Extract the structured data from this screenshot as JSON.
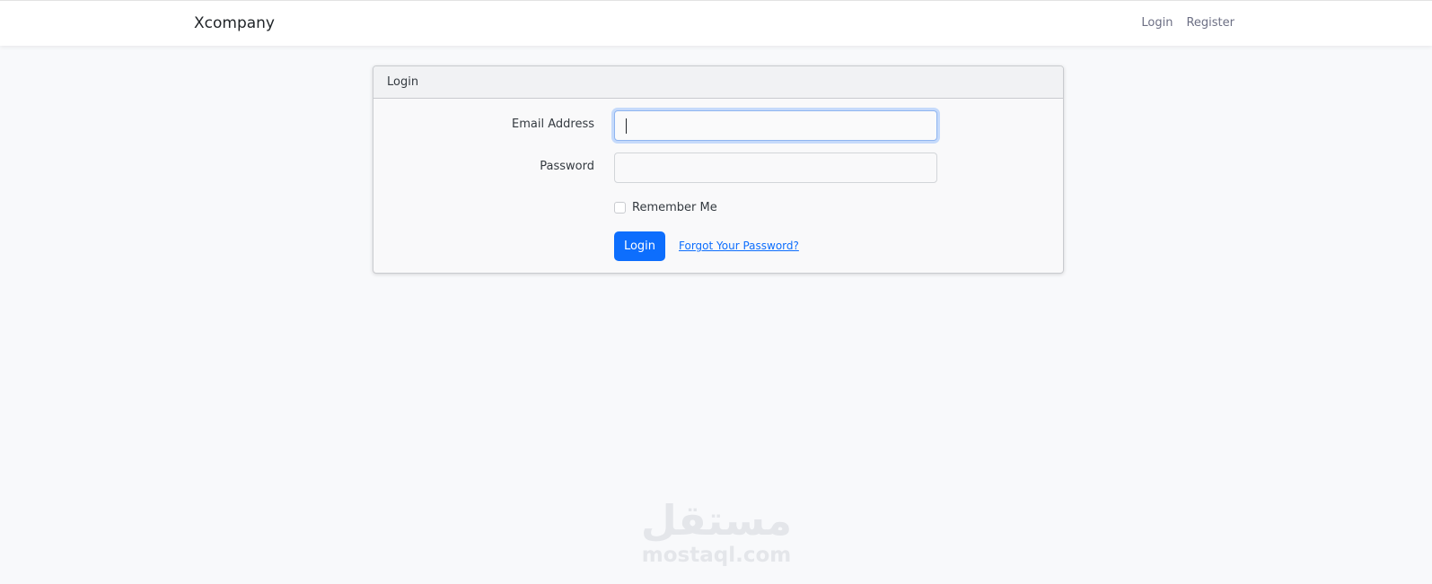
{
  "navbar": {
    "brand": "Xcompany",
    "links": [
      {
        "label": "Login"
      },
      {
        "label": "Register"
      }
    ]
  },
  "card": {
    "header": "Login",
    "email": {
      "label": "Email Address",
      "value": "",
      "placeholder": ""
    },
    "password": {
      "label": "Password",
      "value": "",
      "placeholder": ""
    },
    "remember_label": "Remember Me",
    "remember_checked": false,
    "login_button": "Login",
    "forgot_link": "Forgot Your Password?"
  },
  "watermark": {
    "arabic": "مستقل",
    "latin": "mostaql.com"
  },
  "colors": {
    "accent": "#0d6efd",
    "background": "#f8f9fb",
    "watermark": "#e4e6ea"
  }
}
